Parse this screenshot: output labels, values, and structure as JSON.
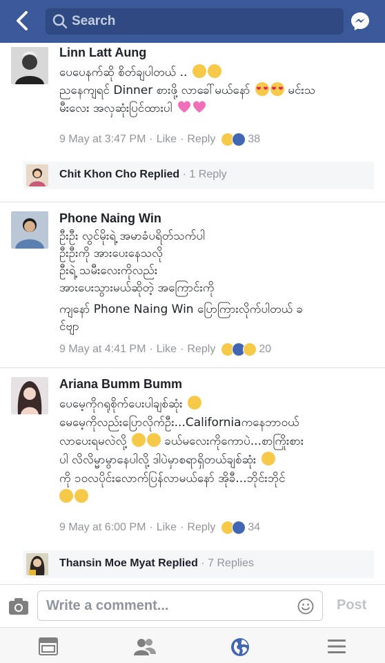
{
  "header": {
    "search_placeholder": "Search"
  },
  "comments": [
    {
      "name": "Linn Latt Aung",
      "lines": [
        "ပေပေနက်ဆို စိတ်ချပါတယ် .. ",
        "ညနေကျရင် Dinner စားဖို့ လာခေါ်မယ်နော် ",
        "မီးလေး အလှဆုံးပြင်ထားပါ "
      ],
      "line2_tail": " မင်းသ",
      "time": "9 May at 3:47 PM",
      "like": "Like",
      "reply": "Reply",
      "reaction_count": "38",
      "reactions": [
        "haha",
        "like"
      ]
    },
    {
      "name": "Phone Naing Win",
      "lines": [
        "ဦးဦး လွင်မိုးရဲ့  အမာခံပရိတ်သက်ပါ",
        "ဦးဦးကို အားပေးနေသလို",
        "ဦးရဲ့  သမီးလေးကိုလည်း",
        "အားပေးသွားမယ်ဆိုတဲ့ အကြောင်းကို"
      ],
      "line5": "ကျနော် Phone Naing Win     ပြောကြားလိုက်ပါတယ် ခ",
      "line6": "င်ဗျာ",
      "time": "9 May at 4:41 PM",
      "like": "Like",
      "reply": "Reply",
      "reaction_count": "20",
      "reactions": [
        "haha",
        "like",
        "sad"
      ]
    },
    {
      "name": "Ariana Bumm Bumm",
      "lines": [
        "ပေမေ့ကိုဂရုစိုက်ပေးပါချစ်ဆုံး ",
        "မေမေ့ကိုလည်းပြောလိုက်ဦး...Californiaကနေဘာဝယ်",
        "လာပေးရမလဲလို့ ",
        "ပါ လိလိမ္မာမွာနေပါလို့ ဒါပဲမှာစရာရှိတယ်ချစ်ဆုံး ",
        "ကို ၁၀လပိုင်းလောက်ပြန်လာမယ်နော် အိုခီ...ဘိုင်းဘိုင်"
      ],
      "line3_tail": " ခယ်မလေးကိုကောပဲ...စာကြိုးစား",
      "time": "9 May at 6:00 PM",
      "like": "Like",
      "reply": "Reply",
      "reaction_count": "34",
      "reactions": [
        "haha",
        "like"
      ]
    }
  ],
  "replies": [
    {
      "name": "Chit Khon Cho Replied",
      "count": " · 1 Reply"
    },
    {
      "name": "Thansin Moe Myat Replied",
      "count": " · 7 Replies"
    }
  ],
  "composer": {
    "placeholder": "Write a comment...",
    "post_label": "Post"
  },
  "colors": {
    "header_bg": "#3b5998",
    "like_blue": "#4267b2",
    "meta_gray": "#90949c"
  }
}
